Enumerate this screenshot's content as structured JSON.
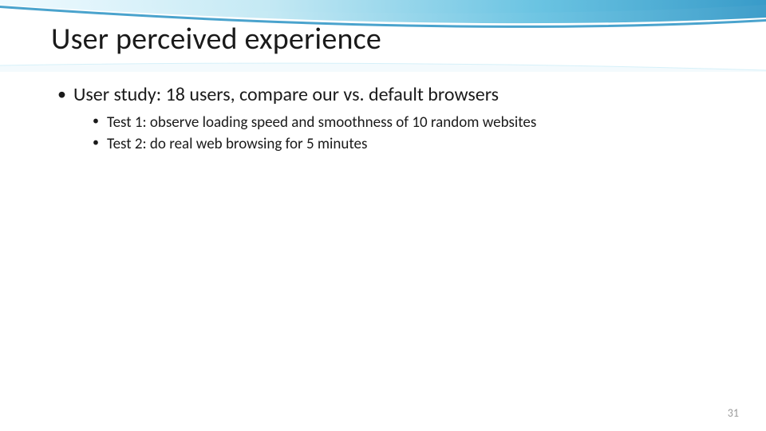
{
  "slide": {
    "title": "User perceived experience",
    "bullets": {
      "level1": "User study: 18 users, compare our vs. default browsers",
      "level2": [
        "Test 1: observe loading speed and smoothness of 10 random websites",
        "Test 2: do real web browsing for 5 minutes"
      ]
    },
    "page_number": "31"
  },
  "theme": {
    "arc_color_outer": "#9ed6ea",
    "arc_color_inner": "#3aa8d8",
    "arc_highlight": "#e8f6fb"
  }
}
